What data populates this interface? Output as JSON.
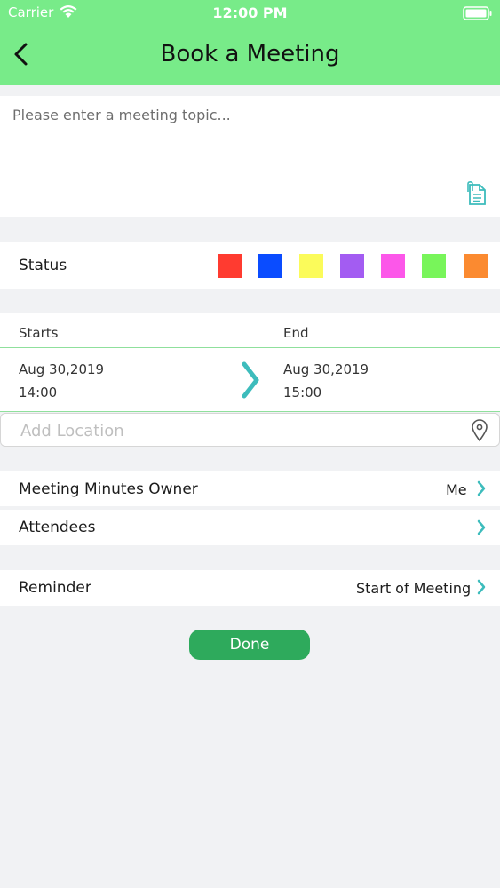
{
  "status_bar": {
    "carrier": "Carrier",
    "time": "12:00 PM"
  },
  "nav": {
    "title": "Book a Meeting",
    "back_icon": "chevron-left-icon"
  },
  "topic": {
    "placeholder": "Please enter a meeting topic...",
    "value": ""
  },
  "status": {
    "label": "Status",
    "colors": [
      "#ff3b30",
      "#0a4cff",
      "#fbfb5a",
      "#a35cf2",
      "#fc57e9",
      "#78f55a",
      "#fb8a30"
    ]
  },
  "time": {
    "starts_label": "Starts",
    "end_label": "End",
    "start_date": "Aug 30,2019",
    "start_time": "14:00",
    "end_date": "Aug 30,2019",
    "end_time": "15:00"
  },
  "location": {
    "placeholder": "Add Location",
    "value": ""
  },
  "rows": {
    "minutes_owner": {
      "label": "Meeting Minutes Owner",
      "value": "Me"
    },
    "attendees": {
      "label": "Attendees"
    },
    "reminder": {
      "label": "Reminder",
      "value": "Start of Meeting"
    }
  },
  "done_label": "Done",
  "colors": {
    "header": "#78eb89",
    "accent": "#3dbcbc",
    "done": "#2eaa5c"
  }
}
